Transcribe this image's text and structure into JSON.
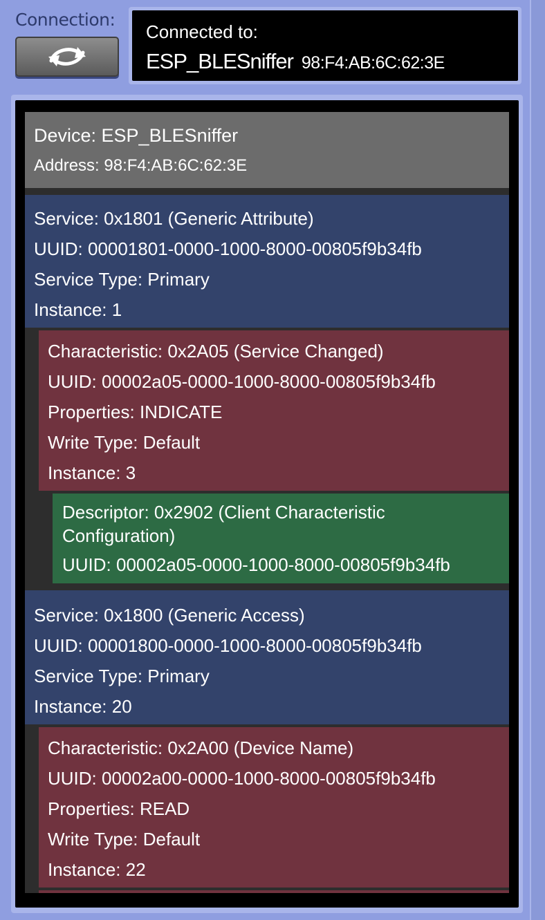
{
  "connection": {
    "label": "Connection:",
    "button_icon": "refresh-icon",
    "status_title": "Connected to:",
    "device_name": "ESP_BLESniffer",
    "device_address": "98:F4:AB:6C:62:3E"
  },
  "colors": {
    "background": "#8f9ee0",
    "device_row": "#6c6c6c",
    "service_row": "#33436b",
    "characteristic_row": "#70333f",
    "descriptor_row": "#2d6b44"
  },
  "gatt": {
    "device": {
      "name": "Device: ESP_BLESniffer",
      "address": "Address: 98:F4:AB:6C:62:3E"
    },
    "service1": {
      "title": "Service: 0x1801 (Generic Attribute)",
      "uuid": "UUID: 00001801-0000-1000-8000-00805f9b34fb",
      "type": "Service Type: Primary",
      "instance": "Instance: 1"
    },
    "char1": {
      "title": "Characteristic: 0x2A05 (Service Changed)",
      "uuid": "UUID: 00002a05-0000-1000-8000-00805f9b34fb",
      "properties": "Properties: INDICATE",
      "write_type": "Write Type: Default",
      "instance": "Instance: 3"
    },
    "desc1": {
      "title": "Descriptor: 0x2902 (Client Characteristic Configuration)",
      "uuid": "UUID: 00002a05-0000-1000-8000-00805f9b34fb"
    },
    "service2": {
      "title": "Service: 0x1800 (Generic Access)",
      "uuid": "UUID: 00001800-0000-1000-8000-00805f9b34fb",
      "type": "Service Type: Primary",
      "instance": "Instance: 20"
    },
    "char2": {
      "title": "Characteristic: 0x2A00 (Device Name)",
      "uuid": "UUID: 00002a00-0000-1000-8000-00805f9b34fb",
      "properties": "Properties: READ",
      "write_type": "Write Type: Default",
      "instance": "Instance: 22"
    }
  }
}
